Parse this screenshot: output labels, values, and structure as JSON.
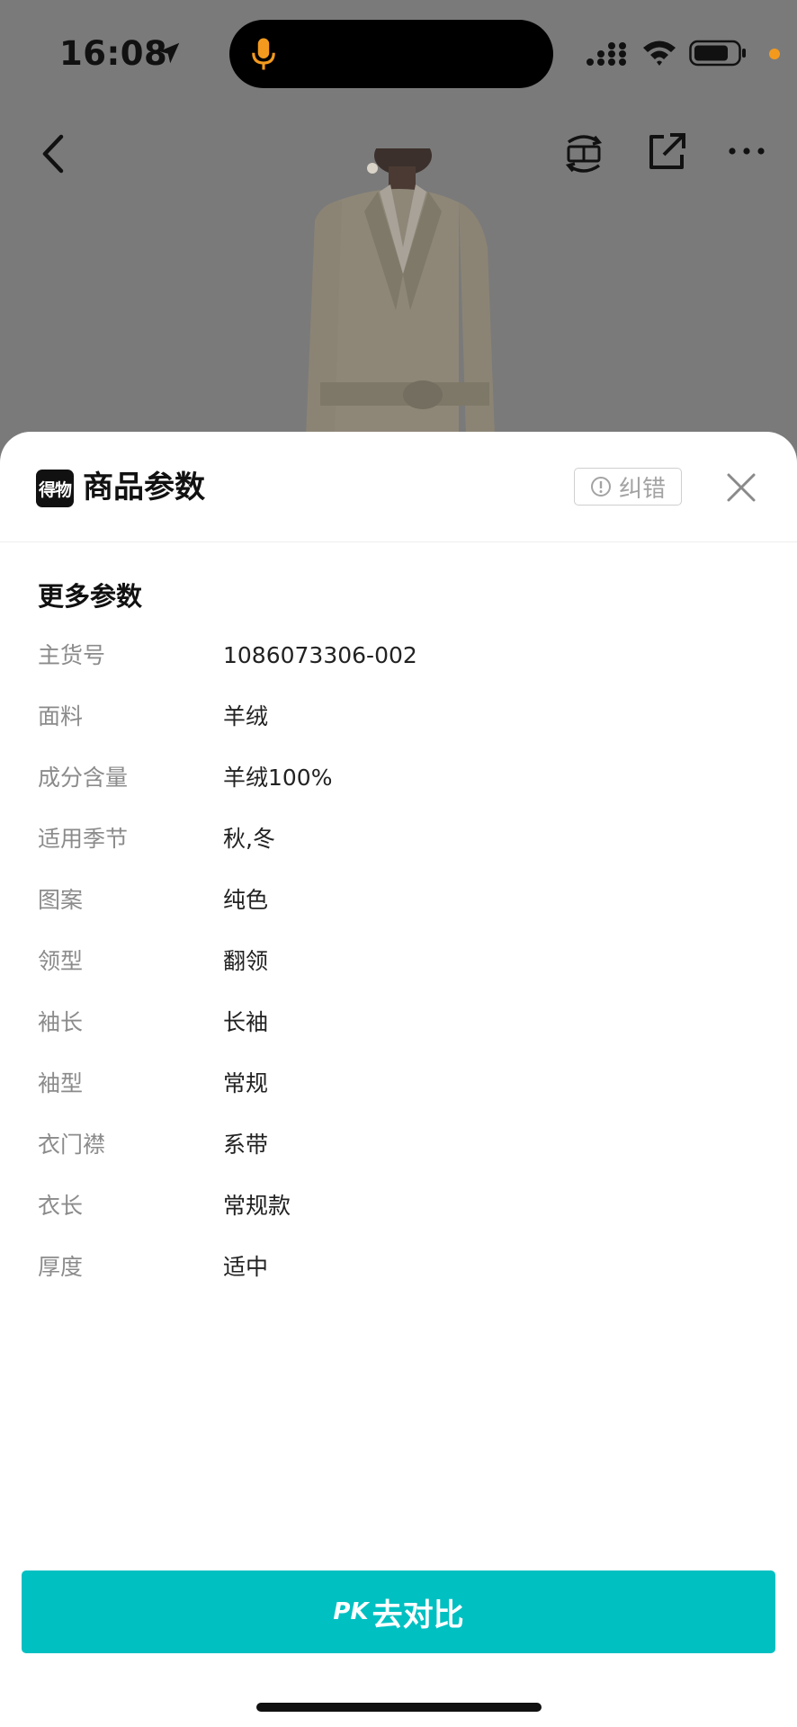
{
  "status_bar": {
    "time": "16:08"
  },
  "sheet": {
    "brand_text": "得物",
    "title": "商品参数",
    "report_label": "纠错",
    "section_title": "更多参数",
    "params": [
      {
        "label": "主货号",
        "value": "1086073306-002"
      },
      {
        "label": "面料",
        "value": "羊绒"
      },
      {
        "label": "成分含量",
        "value": "羊绒100%"
      },
      {
        "label": "适用季节",
        "value": "秋,冬"
      },
      {
        "label": "图案",
        "value": "纯色"
      },
      {
        "label": "领型",
        "value": "翻领"
      },
      {
        "label": "袖长",
        "value": "长袖"
      },
      {
        "label": "袖型",
        "value": "常规"
      },
      {
        "label": "衣门襟",
        "value": "系带"
      },
      {
        "label": "衣长",
        "value": "常规款"
      },
      {
        "label": "厚度",
        "value": "适中"
      }
    ]
  },
  "footer": {
    "pk_prefix": "PK",
    "pk_label": "去对比"
  },
  "colors": {
    "accent": "#00c0c2",
    "overlay": "#7a7a7a",
    "indicator_dot": "#f39a1e"
  },
  "icons": [
    "location-arrow-icon",
    "microphone-icon",
    "signal-icon",
    "wifi-icon",
    "battery-icon",
    "back-arrow-icon",
    "sell-icon",
    "share-icon",
    "more-icon",
    "info-icon",
    "close-icon"
  ]
}
